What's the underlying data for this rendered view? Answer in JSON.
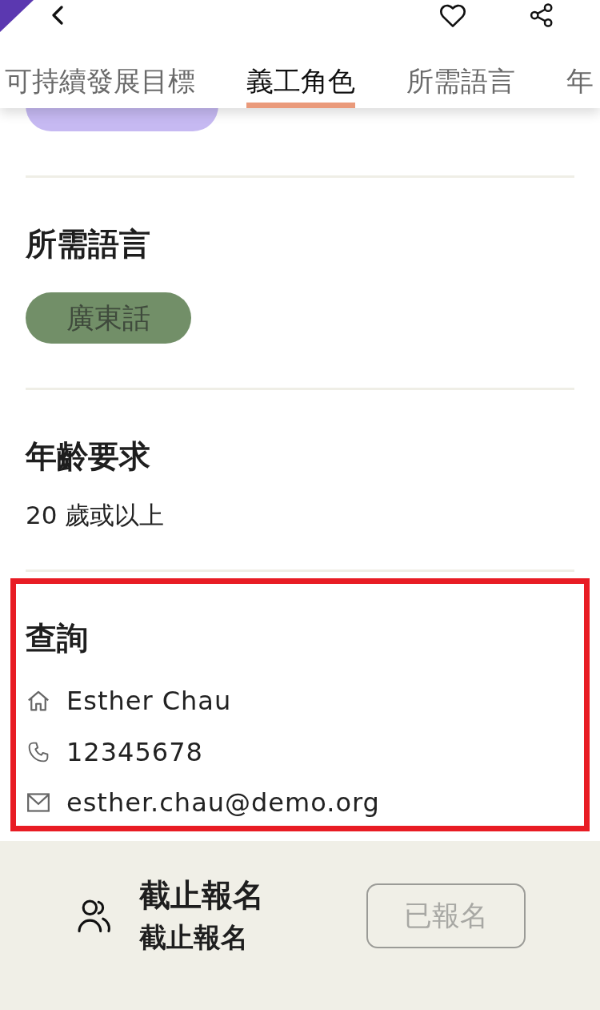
{
  "header": {
    "tabs": [
      {
        "label": "可持續發展目標",
        "selected": false
      },
      {
        "label": "義工角色",
        "selected": true
      },
      {
        "label": "所需語言",
        "selected": false
      },
      {
        "label": "年",
        "selected": false
      }
    ]
  },
  "sections": [
    {
      "kind": "chips",
      "chips": [
        {
          "color": "#c6b9f2"
        }
      ]
    },
    {
      "kind": "chips",
      "title": "所需語言",
      "chips": [
        {
          "label": "廣東話",
          "color": "#728f68"
        }
      ]
    },
    {
      "kind": "text",
      "title": "年齡要求",
      "text": "20 歲或以上"
    },
    {
      "kind": "contact",
      "title": "查詢",
      "highlighted": true,
      "rows": [
        {
          "kind": "name",
          "text": "Esther Chau"
        },
        {
          "kind": "phone",
          "text": "12345678"
        },
        {
          "kind": "email",
          "text": "esther.chau@demo.org"
        }
      ]
    }
  ],
  "footer": {
    "title": "截止報名",
    "subtitle": "截止報名",
    "button": {
      "label": "已報名",
      "disabled": true
    }
  }
}
